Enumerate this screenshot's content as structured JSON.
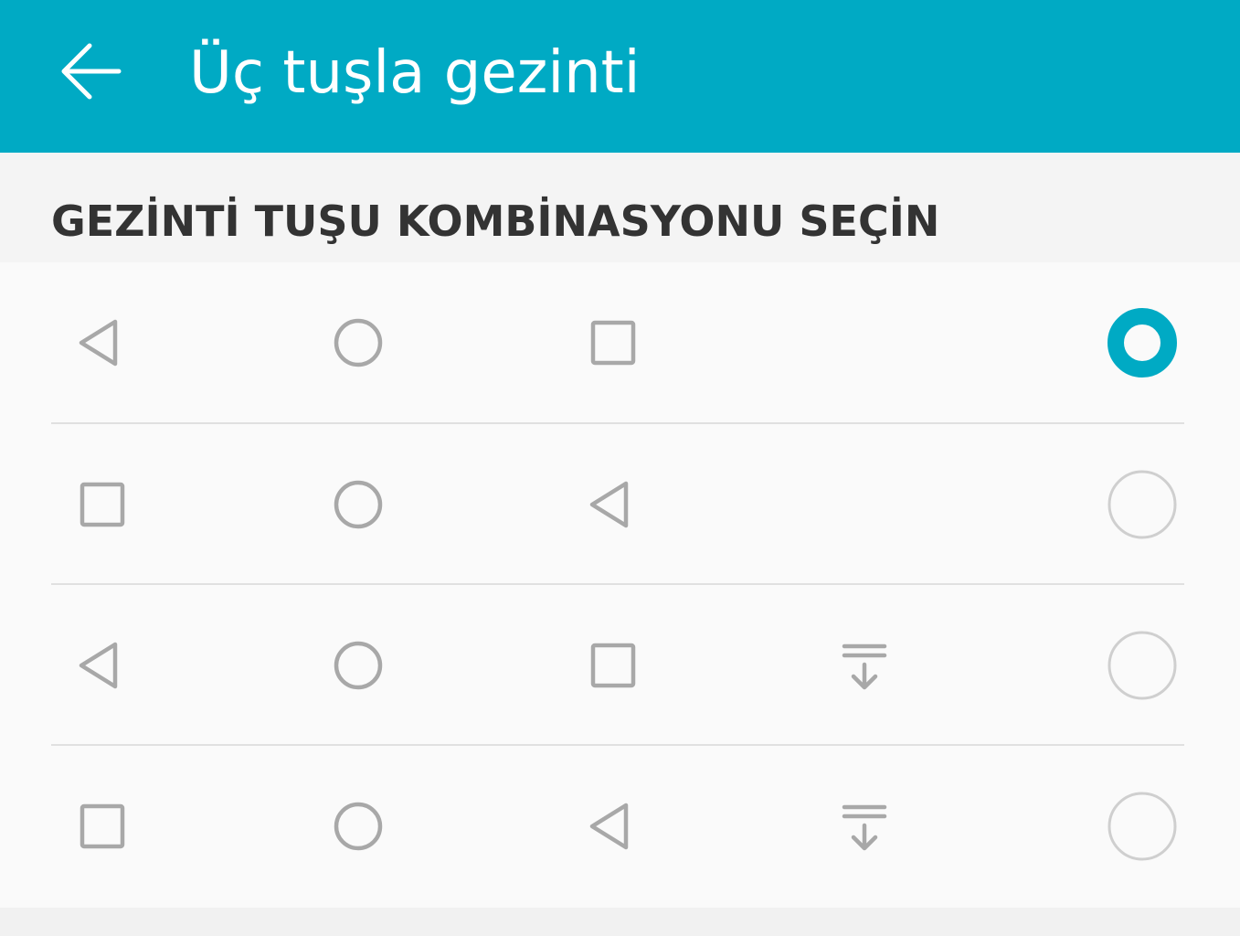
{
  "app_bar": {
    "title": "Üç tuşla gezinti",
    "back_icon": "arrow-left-icon",
    "background_color": "#00aac4"
  },
  "section": {
    "title": "GEZİNTİ TUŞU KOMBİNASYONU SEÇİN"
  },
  "options": [
    {
      "keys": [
        "back-triangle-icon",
        "home-circle-icon",
        "recents-square-icon"
      ],
      "selected": true
    },
    {
      "keys": [
        "recents-square-icon",
        "home-circle-icon",
        "back-triangle-icon"
      ],
      "selected": false
    },
    {
      "keys": [
        "back-triangle-icon",
        "home-circle-icon",
        "recents-square-icon",
        "notification-pulldown-icon"
      ],
      "selected": false
    },
    {
      "keys": [
        "recents-square-icon",
        "home-circle-icon",
        "back-triangle-icon",
        "notification-pulldown-icon"
      ],
      "selected": false
    }
  ],
  "colors": {
    "accent": "#00aac4",
    "icon_gray": "#a8a8a8",
    "radio_unselected": "#cfcfcf"
  }
}
